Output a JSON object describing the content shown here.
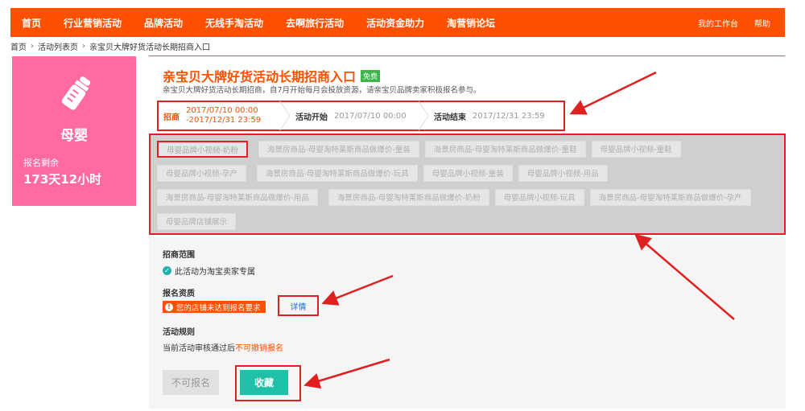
{
  "topnav": {
    "items": [
      "首页",
      "行业营销活动",
      "品牌活动",
      "无线手淘活动",
      "去啊旅行活动",
      "活动资金助力",
      "淘营销论坛"
    ],
    "right": [
      "我的工作台",
      "帮助"
    ],
    "color": "#ff5000"
  },
  "breadcrumb": [
    "首页",
    "活动列表页",
    "亲宝贝大牌好货活动长期招商入口"
  ],
  "sidecard": {
    "icon": "baby-bottle-icon",
    "category": "母婴",
    "remain_label": "报名剩余",
    "remain_value": "173天12小时",
    "color": "#ff6aa1"
  },
  "header": {
    "title": "亲宝贝大牌好货活动长期招商入口",
    "badge": "免费",
    "subtitle": "亲宝贝大牌好货活动长期招商，自7月开始每月会投放资源，请亲宝贝品牌卖家积极报名参与。"
  },
  "steps": [
    {
      "label": "招商",
      "value_line1": "2017/07/10 00:00",
      "value_line2": "-2017/12/31 23:59"
    },
    {
      "label": "活动开始",
      "value": "2017/07/10 00:00"
    },
    {
      "label": "活动结束",
      "value": "2017/12/31 23:59"
    }
  ],
  "tags": [
    [
      "母婴品牌小视频-奶粉",
      "海景房商品-母婴淘特莱斯商品做爆价-童装",
      "海景房商品-母婴淘特莱斯商品做爆价-童鞋",
      "母婴品牌小视频-童鞋"
    ],
    [
      "母婴品牌小视频-孕产",
      "海景房商品-母婴淘特莱斯商品做爆价-玩具",
      "母婴品牌小视频-童装",
      "母婴品牌小视频-用品"
    ],
    [
      "海景房商品-母婴淘特莱斯商品做爆价-用品",
      "海景房商品-母婴淘特莱斯商品做爆价-奶粉",
      "母婴品牌小视频-玩具",
      "海景房商品-母婴淘特莱斯商品做爆价-孕产"
    ],
    [
      "母婴品牌店铺展示"
    ]
  ],
  "panel": {
    "scope_heading": "招商范围",
    "scope_text": "此活动为淘宝卖家专属",
    "qual_heading": "报名资质",
    "qual_warning": "您的店铺未达到报名要求",
    "qual_detail": "详情",
    "rules_heading": "活动规则",
    "rules_text_prefix": "当前活动审核通过后",
    "rules_text_highlight": "不可撤销报名",
    "btn_disabled": "不可报名",
    "btn_fav": "收藏"
  }
}
